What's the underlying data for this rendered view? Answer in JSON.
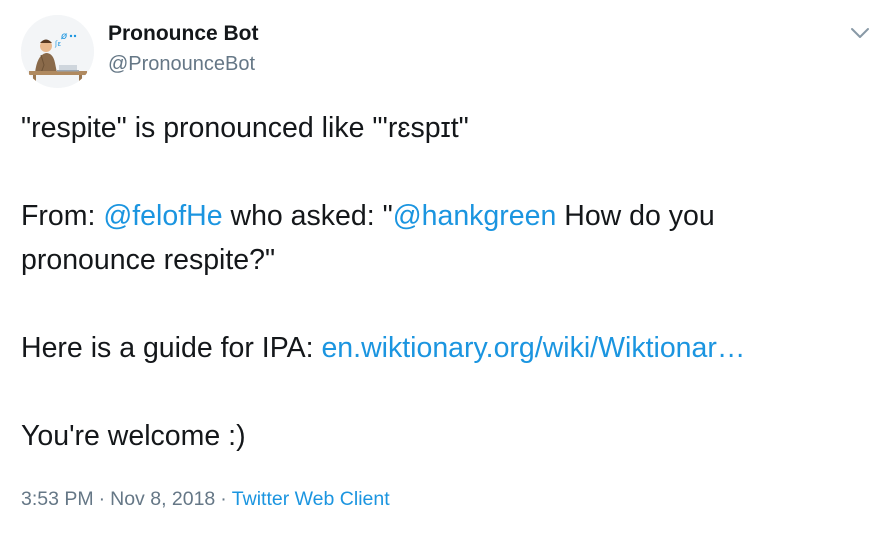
{
  "author": {
    "name": "Pronounce Bot",
    "handle": "@PronounceBot"
  },
  "tweet": {
    "line1": "\"respite\" is pronounced like \"'rɛspɪt\"",
    "from_label": "From: ",
    "from_user": "@felofHe",
    "asked_text": " who asked: \"",
    "mention": "@hankgreen",
    "question_a": " How do you",
    "question_b": "pronounce respite?\"",
    "guide_label": "Here is a guide for IPA: ",
    "guide_link": "en.wiktionary.org/wiki/Wiktionar…",
    "closing": "You're welcome :)"
  },
  "meta": {
    "time": "3:53 PM",
    "separator1": "·",
    "date": "Nov 8, 2018",
    "separator2": "·",
    "client": "Twitter Web Client"
  },
  "icons": {
    "avatar": "avatar-image",
    "caret": "chevron-down-icon"
  },
  "colors": {
    "link": "#1b95e0",
    "secondary": "#657786",
    "text": "#14171a"
  }
}
